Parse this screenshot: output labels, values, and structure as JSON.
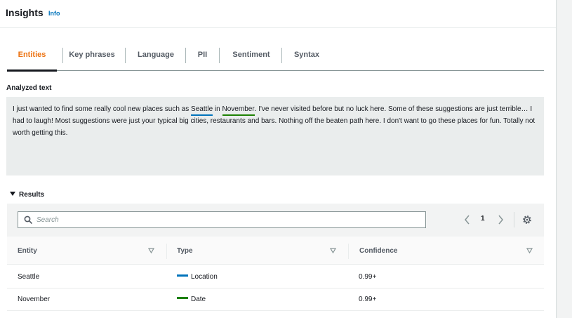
{
  "header": {
    "title": "Insights",
    "info_label": "Info"
  },
  "tabs": [
    {
      "label": "Entities",
      "active": true
    },
    {
      "label": "Key phrases",
      "active": false
    },
    {
      "label": "Language",
      "active": false
    },
    {
      "label": "PII",
      "active": false
    },
    {
      "label": "Sentiment",
      "active": false
    },
    {
      "label": "Syntax",
      "active": false
    }
  ],
  "analyzed": {
    "label": "Analyzed text",
    "text_part1": "I just wanted to find some really cool new places such as ",
    "entity1": "Seattle",
    "text_part2": " in ",
    "entity2": "November",
    "text_part3": ". I've never visited before but no luck here. Some of these suggestions are just terrible… I had to laugh! Most suggestions were just your typical big cities, restaurants and bars. Nothing off the beaten path here. I don't want to go these places for fun. Totally not worth getting this."
  },
  "results": {
    "label": "Results",
    "search_placeholder": "Search",
    "search_value": "",
    "page": "1",
    "columns": [
      "Entity",
      "Type",
      "Confidence"
    ],
    "rows": [
      {
        "entity": "Seattle",
        "type": "Location",
        "confidence": "0.99+"
      },
      {
        "entity": "November",
        "type": "Date",
        "confidence": "0.99+"
      }
    ]
  },
  "colors": {
    "accent_tab": "#ec7211",
    "location": "#0073bb",
    "date": "#1d8102",
    "link": "#0073bb"
  },
  "icons": {
    "search": "search-icon",
    "prev": "chevron-left-icon",
    "next": "chevron-right-icon",
    "settings": "gear-icon",
    "sort": "sort-caret-down-icon",
    "collapse": "caret-down-icon"
  }
}
